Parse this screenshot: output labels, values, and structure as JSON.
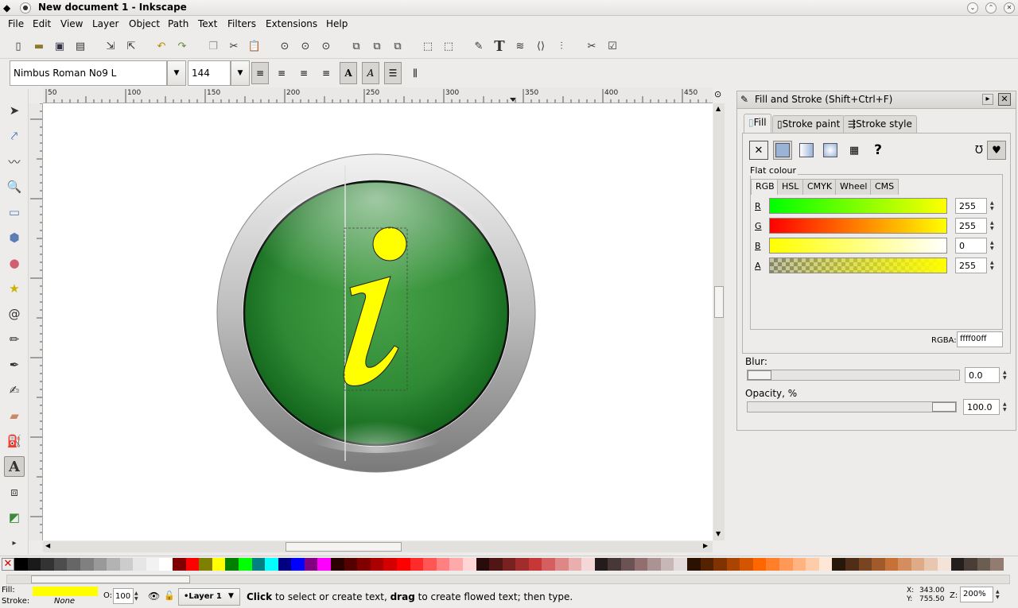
{
  "window": {
    "title": "New document 1 - Inkscape",
    "ctrl_min": "⌄",
    "ctrl_max": "⌃",
    "ctrl_close": "✕"
  },
  "menu": [
    "File",
    "Edit",
    "View",
    "Layer",
    "Object",
    "Path",
    "Text",
    "Filters",
    "Extensions",
    "Help"
  ],
  "textbar": {
    "font": "Nimbus Roman No9 L",
    "size": "144"
  },
  "ruler_labels": [
    "50",
    "100",
    "150",
    "200",
    "250",
    "300",
    "350",
    "400",
    "450"
  ],
  "fill_stroke": {
    "title": "Fill and Stroke (Shift+Ctrl+F)",
    "tabs": [
      "Fill",
      "Stroke paint",
      "Stroke style"
    ],
    "flat_label": "Flat colour",
    "modes": [
      "RGB",
      "HSL",
      "CMYK",
      "Wheel",
      "CMS"
    ],
    "channels": [
      {
        "label": "R",
        "value": "255"
      },
      {
        "label": "G",
        "value": "255"
      },
      {
        "label": "B",
        "value": "0"
      },
      {
        "label": "A",
        "value": "255"
      }
    ],
    "rgba_label": "RGBA:",
    "rgba": "ffff00ff",
    "blur_label": "Blur:",
    "blur": "0.0",
    "opacity_label": "Opacity, %",
    "opacity": "100.0",
    "unknown_paint": "?"
  },
  "colors": {
    "fill": "#ffff00",
    "accent": "#6c8ebf"
  },
  "status": {
    "fill_label": "Fill:",
    "stroke_label": "Stroke:",
    "stroke_value": "None",
    "o_label": "O:",
    "opacity": "100",
    "layer": "•Layer 1",
    "msg_b1": "Click",
    "msg_1": " to select or create text, ",
    "msg_b2": "drag",
    "msg_2": " to create flowed text; then type.",
    "x_label": "X:",
    "x": "343.00",
    "y_label": "Y:",
    "y": "755.50",
    "z_label": "Z:",
    "zoom": "200%"
  }
}
